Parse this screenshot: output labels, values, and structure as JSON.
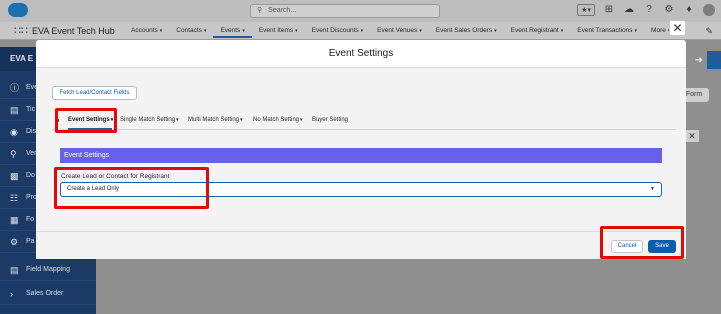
{
  "header": {
    "search_placeholder": "Search...",
    "search_icon": "search-icon"
  },
  "nav": {
    "app_name": "EVA Event Tech Hub",
    "items": [
      {
        "label": "Accounts"
      },
      {
        "label": "Contacts"
      },
      {
        "label": "Events",
        "active": true
      },
      {
        "label": "Event Items"
      },
      {
        "label": "Event Discounts"
      },
      {
        "label": "Event Venues"
      },
      {
        "label": "Event Sales Orders"
      },
      {
        "label": "Event Registrant"
      },
      {
        "label": "Event Transactions"
      },
      {
        "label": "More"
      }
    ]
  },
  "left_nav": {
    "header": "EVA E",
    "items": [
      {
        "label": "Eve",
        "icon": "info-icon"
      },
      {
        "label": "Tic",
        "icon": "ticket-icon"
      },
      {
        "label": "Dis",
        "icon": "discount-icon"
      },
      {
        "label": "Ven",
        "icon": "location-icon"
      },
      {
        "label": "Do",
        "icon": "document-icon"
      },
      {
        "label": "Pro",
        "icon": "barcode-icon"
      },
      {
        "label": "Fo",
        "icon": "form-icon"
      },
      {
        "label": "Pa",
        "icon": "gear-icon"
      },
      {
        "label": "Field Mapping",
        "icon": "mapping-icon"
      },
      {
        "label": "Sales Order",
        "icon": "chevron-right-icon"
      }
    ]
  },
  "background": {
    "form_button": "Form"
  },
  "modal": {
    "title": "Event Settings",
    "fetch_button": "Fetch Lead/Contact Fields",
    "tabs": [
      {
        "label": "Event Settings",
        "active": true
      },
      {
        "label": "Single Match Setting"
      },
      {
        "label": "Multi Match Setting"
      },
      {
        "label": "No Match Setting"
      },
      {
        "label": "Buyer Setting"
      }
    ],
    "section_title": "Event Settings",
    "field_label": "Create Lead or Contact for Registrant",
    "field_value": "Create a Lead Only",
    "cancel_label": "Cancel",
    "save_label": "Save"
  },
  "colors": {
    "section_bar": "#6760e8",
    "brand_blue": "#0b5cab",
    "callout": "#e10a0a"
  }
}
